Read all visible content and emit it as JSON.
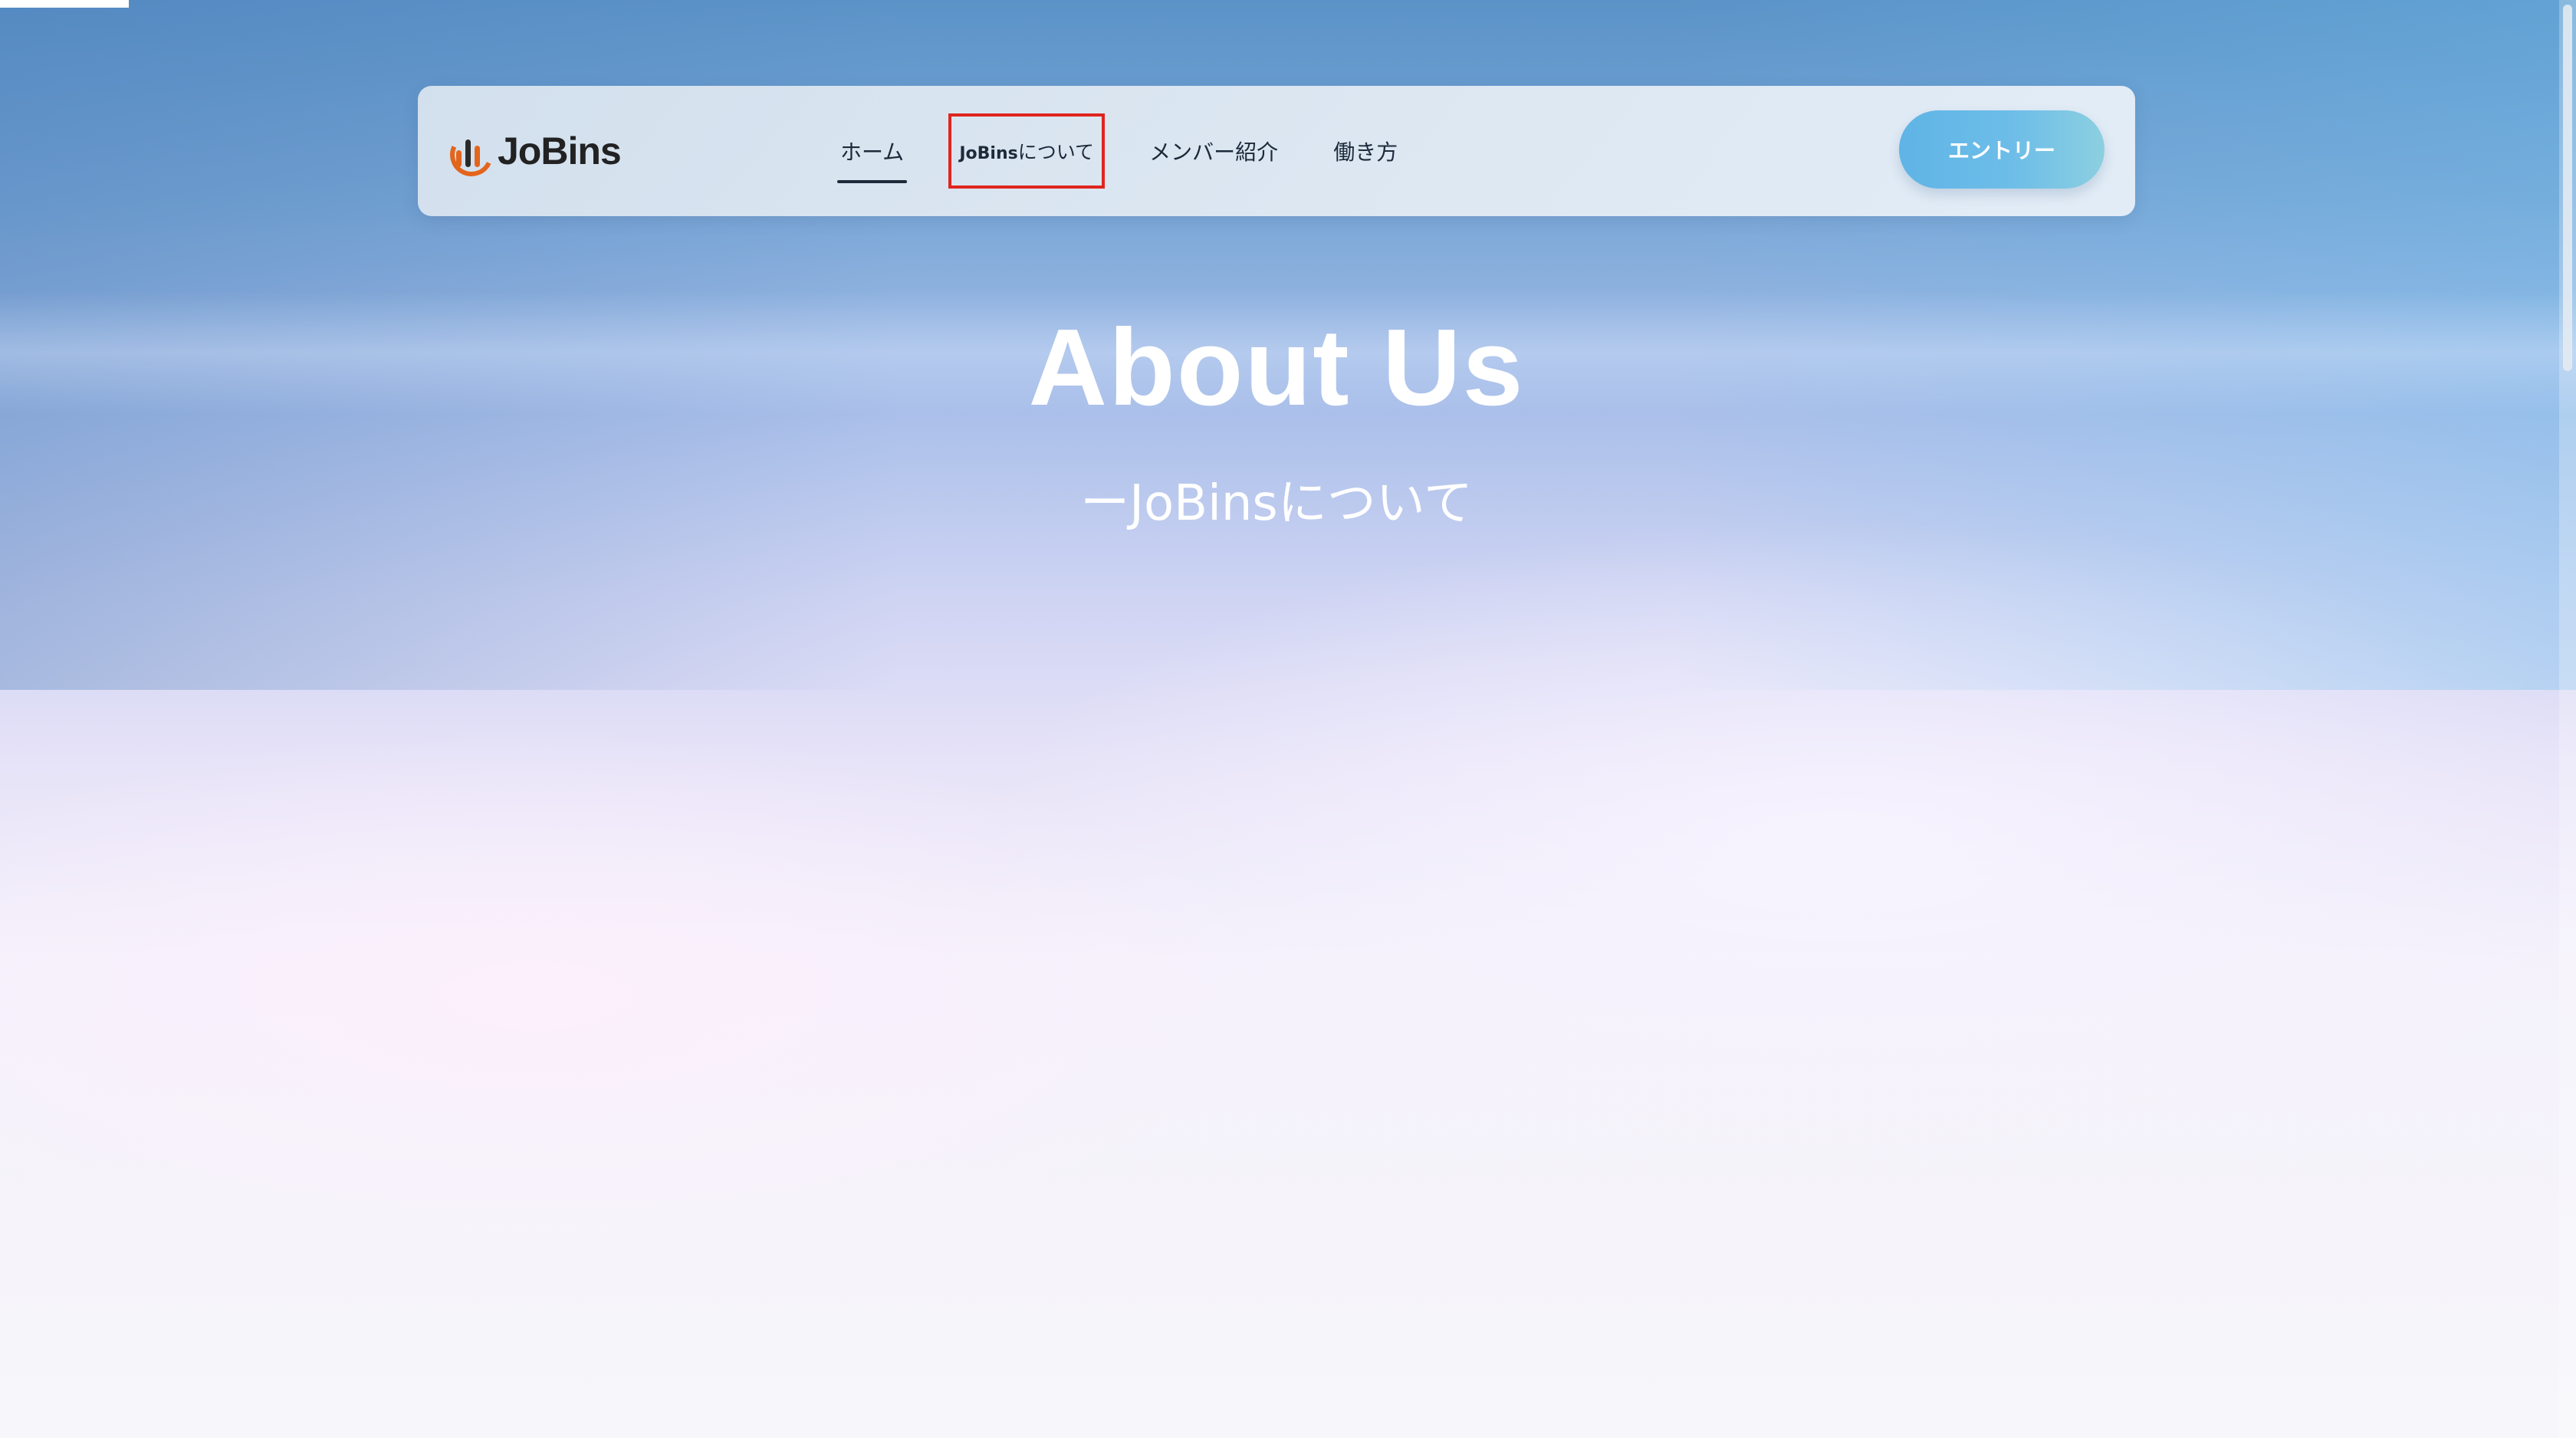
{
  "header": {
    "logo_text": "JoBins",
    "nav": [
      {
        "label": "ホーム",
        "active": true
      },
      {
        "label_brand": "JoBins",
        "label_rest": "について",
        "highlighted": true
      },
      {
        "label": "メンバー紹介"
      },
      {
        "label": "働き方"
      }
    ],
    "entry_button": "エントリー"
  },
  "hero": {
    "title": "About Us",
    "subtitle": "ーJoBinsについて"
  },
  "colors": {
    "accent_button": "#6dbde8",
    "highlight_box": "#e0251e",
    "logo_orange": "#e3651d",
    "text_dark": "#1d2a3a"
  }
}
